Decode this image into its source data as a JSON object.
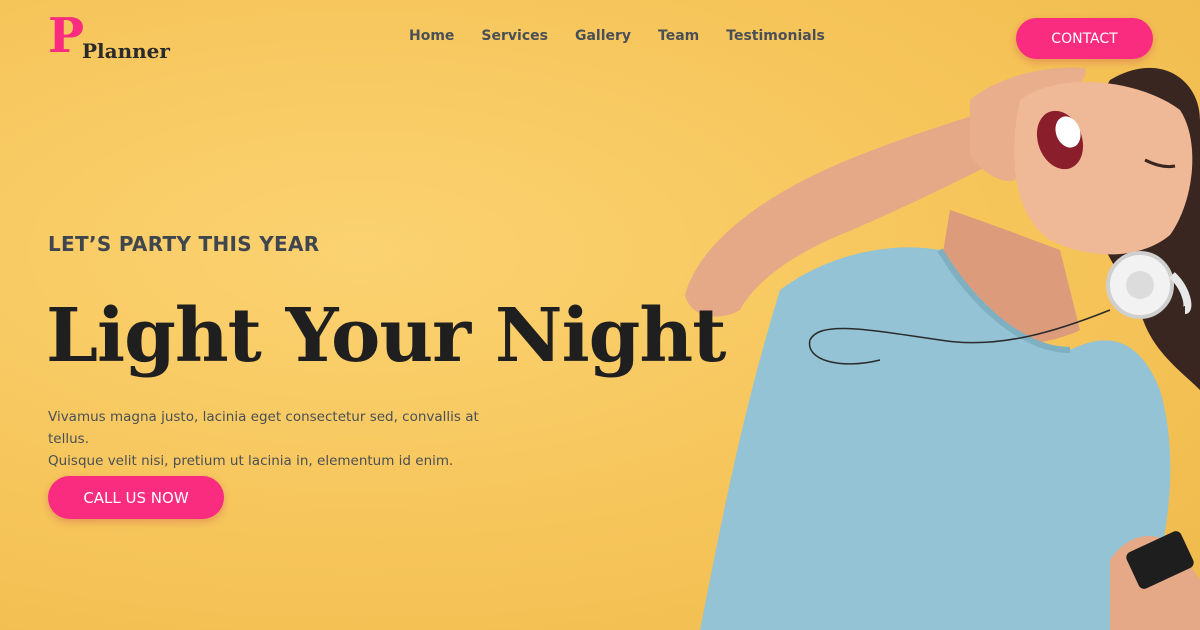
{
  "brand": {
    "logo_letter": "P",
    "logo_text": "Planner",
    "accent_color": "#fa2c7f",
    "background_color": "#f7c85b"
  },
  "nav": {
    "items": [
      {
        "label": "Home"
      },
      {
        "label": "Services"
      },
      {
        "label": "Gallery"
      },
      {
        "label": "Team"
      },
      {
        "label": "Testimonials"
      }
    ],
    "contact_label": "CONTACT"
  },
  "hero": {
    "kicker": "LET’S PARTY THIS YEAR",
    "headline": "Light Your Night",
    "description_line1": "Vivamus magna justo, lacinia eget consectetur sed, convallis at tellus.",
    "description_line2": "Quisque velit nisi, pretium ut lacinia in, elementum id enim.",
    "cta_label": "CALL US NOW"
  }
}
